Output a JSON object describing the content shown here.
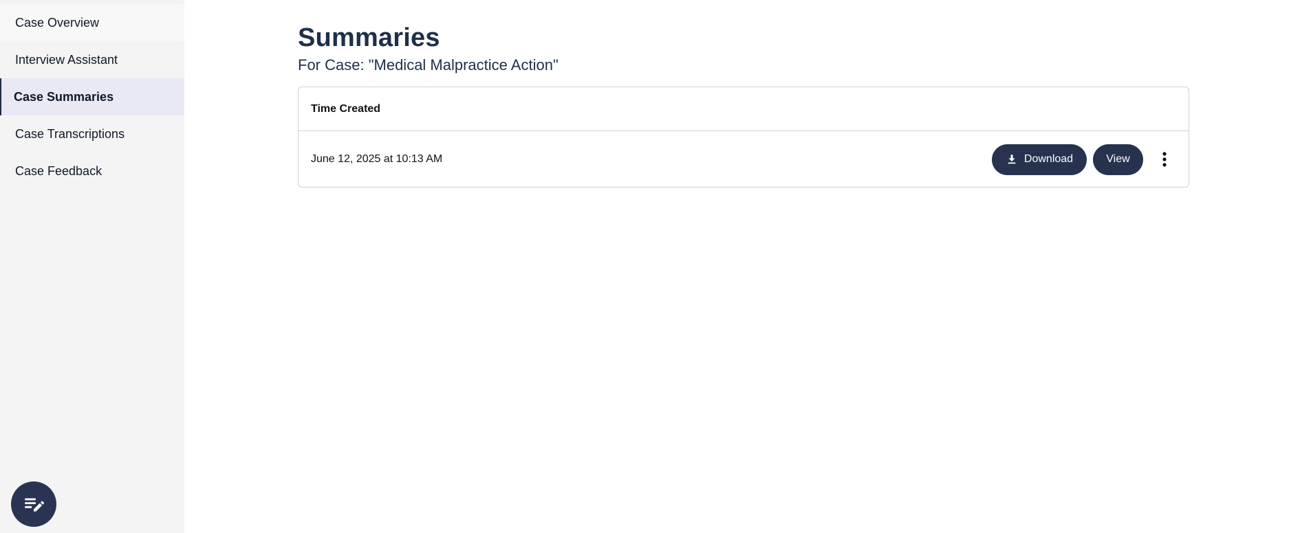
{
  "sidebar": {
    "items": [
      {
        "label": "Case Overview"
      },
      {
        "label": "Interview Assistant"
      },
      {
        "label": "Case Summaries"
      },
      {
        "label": "Case Transcriptions"
      },
      {
        "label": "Case Feedback"
      }
    ],
    "active_index": 2,
    "fab_icon": "edit-note-icon"
  },
  "page": {
    "title": "Summaries",
    "subtitle": "For Case: \"Medical Malpractice Action\""
  },
  "table": {
    "column_header": "Time Created",
    "rows": [
      {
        "time_created": "June 12, 2025 at 10:13 AM",
        "download_label": "Download",
        "view_label": "View"
      }
    ]
  },
  "colors": {
    "button_bg": "#27324f",
    "title": "#1e3048",
    "sidebar_bg": "#f4f4f5",
    "active_item_bg": "#e8e9f3"
  }
}
